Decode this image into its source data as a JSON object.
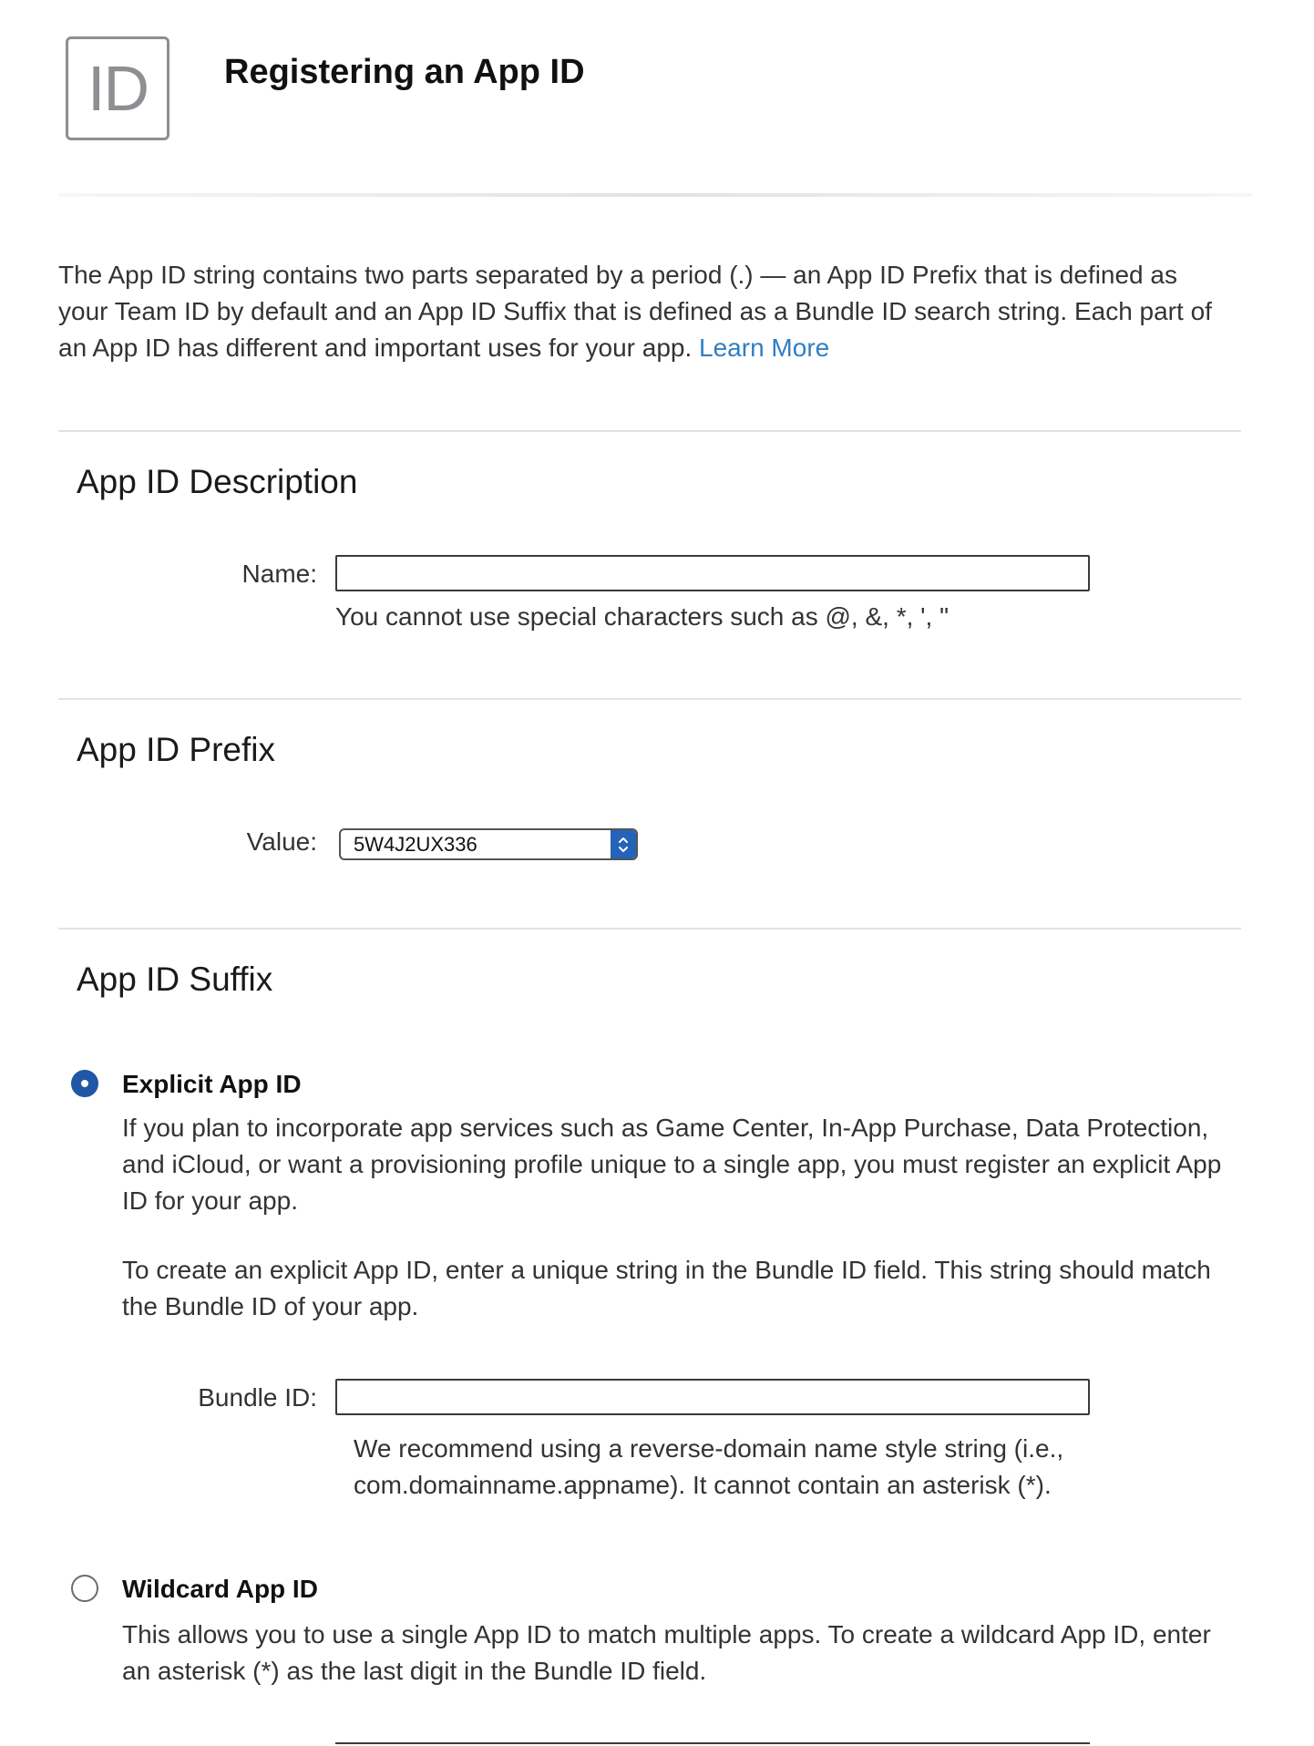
{
  "header": {
    "logo_text": "ID",
    "title": "Registering an App ID"
  },
  "intro": {
    "text": "The App ID string contains two parts separated by a period (.) — an App ID Prefix that is defined as your Team ID by default and an App ID Suffix that is defined as a Bundle ID search string. Each part of an App ID has different and important uses for your app.",
    "link_label": "Learn More"
  },
  "description_section": {
    "heading": "App ID Description",
    "name_label": "Name:",
    "name_value": "",
    "name_hint": "You cannot use special characters such as @, &, *, ', \""
  },
  "prefix_section": {
    "heading": "App ID Prefix",
    "value_label": "Value:",
    "selected_value": "5W4J2UX336"
  },
  "suffix_section": {
    "heading": "App ID Suffix",
    "explicit": {
      "selected": true,
      "title": "Explicit App ID",
      "description": "If you plan to incorporate app services such as Game Center, In-App Purchase, Data Protection, and iCloud, or want a provisioning profile unique to a single app, you must register an explicit App ID for your app.",
      "instructions": "To create an explicit App ID, enter a unique string in the Bundle ID field. This string should match the Bundle ID of your app.",
      "bundle_label": "Bundle ID:",
      "bundle_value": "",
      "bundle_hint": "We recommend using a reverse-domain name style string (i.e., com.domainname.appname). It cannot contain an asterisk (*)."
    },
    "wildcard": {
      "selected": false,
      "title": "Wildcard App ID",
      "description": "This allows you to use a single App ID to match multiple apps. To create a wildcard App ID, enter an asterisk (*) as the last digit in the Bundle ID field."
    }
  },
  "colors": {
    "link": "#2f7fc4",
    "radio_selected": "#1f56a7",
    "select_arrow_bg": "#2563b8"
  }
}
